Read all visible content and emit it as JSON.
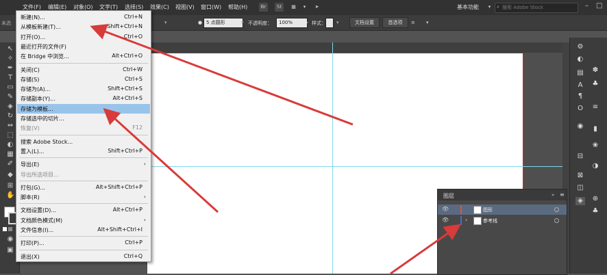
{
  "menubar": {
    "items": [
      "文件(F)",
      "编辑(E)",
      "对象(O)",
      "文字(T)",
      "选择(S)",
      "效果(C)",
      "视图(V)",
      "窗口(W)",
      "帮助(H)"
    ],
    "icons": [
      "Br",
      "St"
    ],
    "workspace": "基本功能",
    "search_placeholder": "搜索 Adobe Stock"
  },
  "controlbar": {
    "doc_label": "未选",
    "stroke_value": "5 点圆形",
    "opacity_label": "不透明度：",
    "opacity_value": "100%",
    "style_label": "样式：",
    "doc_settings": "文档设置",
    "preferences": "首选项"
  },
  "file_menu": [
    {
      "label": "新建(N)...",
      "shortcut": "Ctrl+N",
      "disabled": false,
      "highlight": false,
      "submenu": false
    },
    {
      "label": "从模板新建(T)...",
      "shortcut": "Shift+Ctrl+N",
      "disabled": false,
      "highlight": false,
      "submenu": false
    },
    {
      "label": "打开(O)...",
      "shortcut": "Ctrl+O",
      "disabled": false,
      "highlight": false,
      "submenu": false
    },
    {
      "label": "最近打开的文件(F)",
      "shortcut": "",
      "disabled": false,
      "highlight": false,
      "submenu": true
    },
    {
      "label": "在 Bridge 中浏览...",
      "shortcut": "Alt+Ctrl+O",
      "disabled": false,
      "highlight": false,
      "submenu": false
    },
    {
      "label": "关闭(C)",
      "shortcut": "Ctrl+W",
      "disabled": false,
      "highlight": false,
      "submenu": false
    },
    {
      "label": "存储(S)",
      "shortcut": "Ctrl+S",
      "disabled": false,
      "highlight": false,
      "submenu": false
    },
    {
      "label": "存储为(A)...",
      "shortcut": "Shift+Ctrl+S",
      "disabled": false,
      "highlight": false,
      "submenu": false
    },
    {
      "label": "存储副本(Y)...",
      "shortcut": "Alt+Ctrl+S",
      "disabled": false,
      "highlight": false,
      "submenu": false
    },
    {
      "label": "存储为模板...",
      "shortcut": "",
      "disabled": false,
      "highlight": true,
      "submenu": false
    },
    {
      "label": "存储选中的切片...",
      "shortcut": "",
      "disabled": false,
      "highlight": false,
      "submenu": false
    },
    {
      "label": "恢复(V)",
      "shortcut": "F12",
      "disabled": true,
      "highlight": false,
      "submenu": false
    },
    {
      "label": "搜索 Adobe Stock...",
      "shortcut": "",
      "disabled": false,
      "highlight": false,
      "submenu": false
    },
    {
      "label": "置入(L)...",
      "shortcut": "Shift+Ctrl+P",
      "disabled": false,
      "highlight": false,
      "submenu": false
    },
    {
      "label": "导出(E)",
      "shortcut": "",
      "disabled": false,
      "highlight": false,
      "submenu": true
    },
    {
      "label": "导出所选项目...",
      "shortcut": "",
      "disabled": true,
      "highlight": false,
      "submenu": false
    },
    {
      "label": "打包(G)...",
      "shortcut": "Alt+Shift+Ctrl+P",
      "disabled": false,
      "highlight": false,
      "submenu": false
    },
    {
      "label": "脚本(R)",
      "shortcut": "",
      "disabled": false,
      "highlight": false,
      "submenu": true
    },
    {
      "label": "文档设置(D)...",
      "shortcut": "Alt+Ctrl+P",
      "disabled": false,
      "highlight": false,
      "submenu": false
    },
    {
      "label": "文档颜色模式(M)",
      "shortcut": "",
      "disabled": false,
      "highlight": false,
      "submenu": true
    },
    {
      "label": "文件信息(I)...",
      "shortcut": "Alt+Shift+Ctrl+I",
      "disabled": false,
      "highlight": false,
      "submenu": false
    },
    {
      "label": "打印(P)...",
      "shortcut": "Ctrl+P",
      "disabled": false,
      "highlight": false,
      "submenu": false
    },
    {
      "label": "退出(X)",
      "shortcut": "Ctrl+Q",
      "disabled": false,
      "highlight": false,
      "submenu": false
    }
  ],
  "layers_panel": {
    "title": "图层",
    "layers": [
      {
        "name": "图形",
        "color": "#e0504a",
        "selected": true
      },
      {
        "name": "参考线",
        "color": "#4a6ad8",
        "selected": false
      }
    ]
  },
  "colors": {
    "annotation_arrow": "#d93a3a",
    "guide": "#7fd8e8",
    "menu_highlight": "#99c4ea"
  }
}
